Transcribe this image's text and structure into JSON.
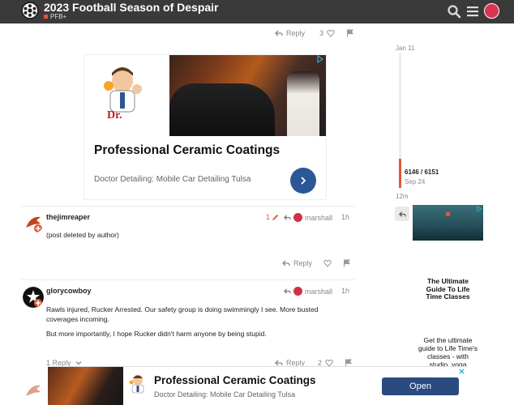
{
  "header": {
    "title": "2023 Football Season of Despair",
    "category": "PFB+",
    "icons": [
      "search-icon",
      "hamburger-menu-icon",
      "user-avatar"
    ]
  },
  "top_post_actions": {
    "reply_label": "Reply",
    "like_count": "3"
  },
  "ad_main": {
    "headline": "Professional Ceramic Coatings",
    "advertiser": "Doctor Detailing: Mobile Car Detailing Tulsa"
  },
  "posts": [
    {
      "username": "thejimreaper",
      "edit_count": "1",
      "reply_to": "marshall",
      "time": "1h",
      "body": "(post deleted by author)",
      "reply_label": "Reply"
    },
    {
      "username": "glorycowboy",
      "reply_to": "marshall",
      "time": "1h",
      "body_1": "Rawls injured, Rucker Arrested. Our safety group is doing swimmingly I see. More busted coverages incoming.",
      "body_2": "But more importantly, I hope Rucker didn't harm anyone by being stupid.",
      "replies_label": "1 Reply",
      "reply_label": "Reply",
      "like_count": "2"
    }
  ],
  "timeline": {
    "start_date": "Jan 11",
    "position": "6146 / 6151",
    "current_date": "Sep 24",
    "ago": "12m"
  },
  "side_ad": {
    "title": "The Ultimate Guide To Life Time Classes",
    "description": "Get the ultimate guide to Life Time's classes - with studio, yoga"
  },
  "bottom_ad": {
    "headline": "Professional Ceramic Coatings",
    "advertiser": "Doctor Detailing: Mobile Car Detailing Tulsa",
    "cta": "Open"
  },
  "colors": {
    "header_bg": "#3a3a3a",
    "accent": "#e45735",
    "ad_button": "#2b5797"
  }
}
